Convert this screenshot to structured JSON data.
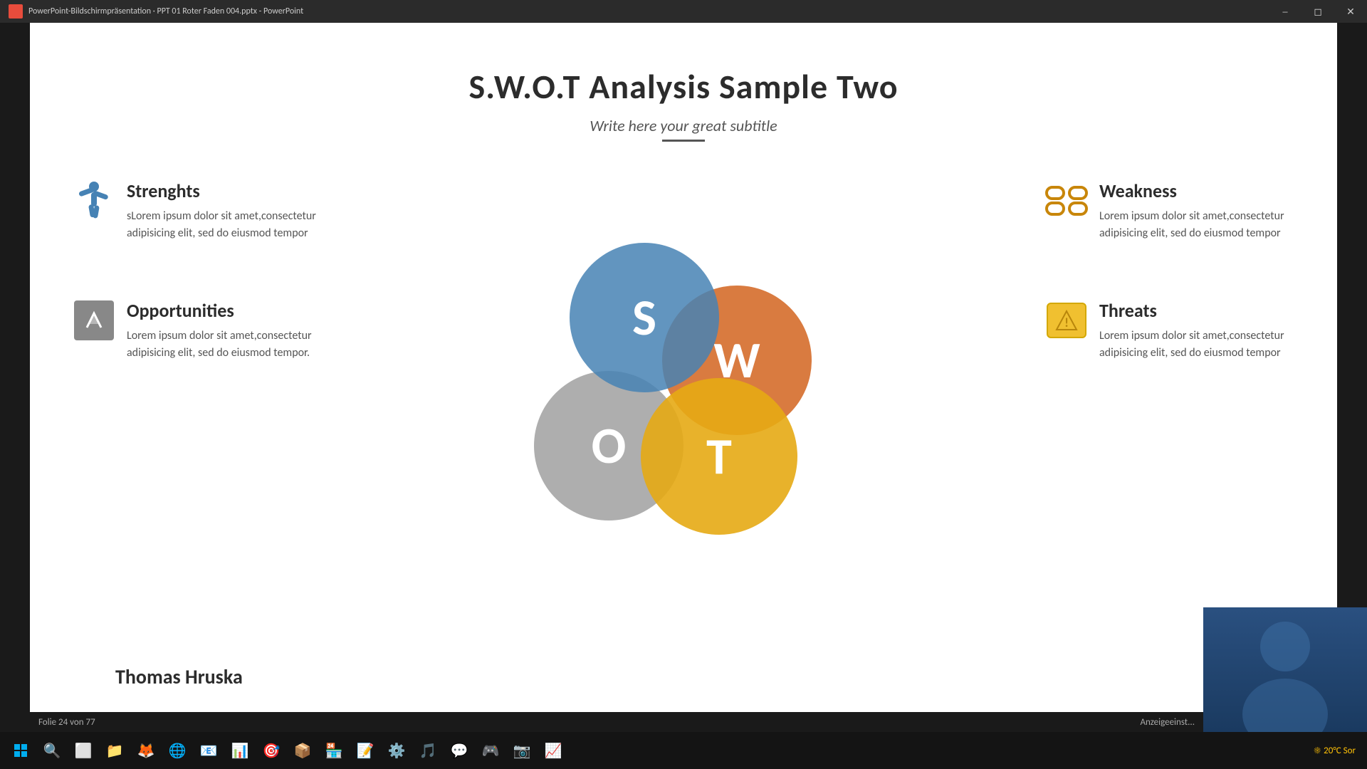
{
  "titleBar": {
    "text": "PowerPoint-Bildschirmpräsentation  ·  PPT 01 Roter Faden 004.pptx - PowerPoint",
    "buttons": [
      "minimize",
      "maximize",
      "close"
    ]
  },
  "slide": {
    "title": "S.W.O.T Analysis Sample Two",
    "subtitle": "Write here your great subtitle",
    "author": "Thomas Hruska",
    "strengths": {
      "label": "Strenghts",
      "body": "sLorem ipsum dolor sit amet,consectetur adipisicing elit, sed do eiusmod tempor"
    },
    "weakness": {
      "label": "Weakness",
      "body": "Lorem ipsum dolor sit amet,consectetur adipisicing elit, sed do eiusmod tempor"
    },
    "opportunities": {
      "label": "Opportunities",
      "body": "Lorem ipsum dolor sit amet,consectetur adipisicing elit, sed do eiusmod tempor."
    },
    "threats": {
      "label": "Threats",
      "body": "Lorem ipsum dolor sit amet,consectetur adipisicing elit, sed do eiusmod tempor"
    },
    "venn": {
      "s_label": "S",
      "w_label": "W",
      "o_label": "O",
      "t_label": "T"
    }
  },
  "statusBar": {
    "slideInfo": "Folie 24 von 77",
    "displayInfo": "Anzeigeeinst..."
  },
  "taskbar": {
    "weather": "20°C  Sor"
  }
}
